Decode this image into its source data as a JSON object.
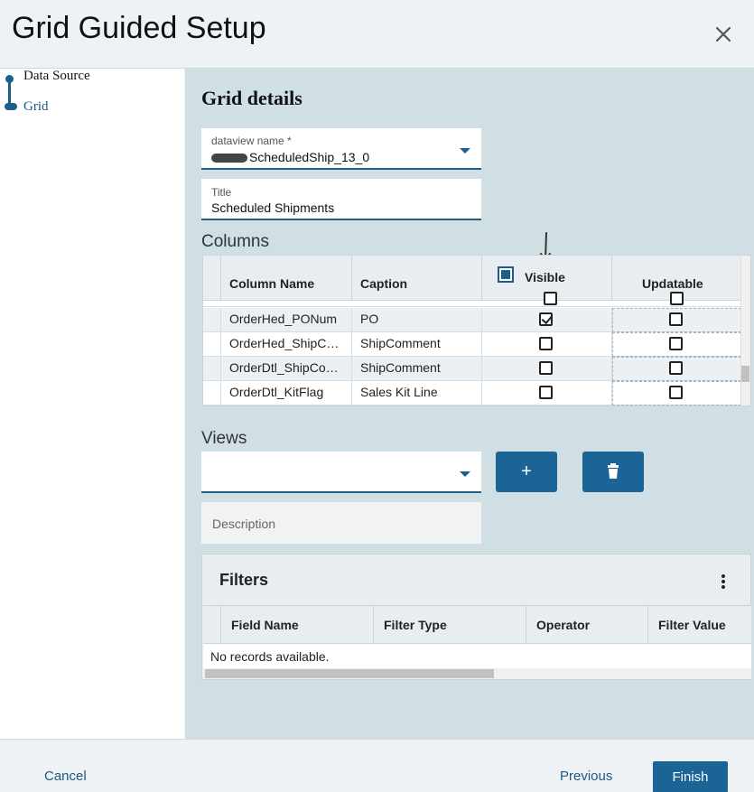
{
  "header": {
    "title": "Grid Guided Setup",
    "close_icon": "close-icon"
  },
  "steps": [
    {
      "label": "Data Source"
    },
    {
      "label": "Grid"
    }
  ],
  "main": {
    "section_title": "Grid details",
    "dataview": {
      "label": "dataview name *",
      "value": "ScheduledShip_13_0"
    },
    "title_field": {
      "label": "Title",
      "value": "Scheduled Shipments"
    },
    "columns_heading": "Columns",
    "columns_grid": {
      "headers": [
        "Column Name",
        "Caption",
        "Visible",
        "Updatable"
      ],
      "rows": [
        {
          "name": "OrderHed_PONum",
          "caption": "PO",
          "visible": true,
          "updatable": false
        },
        {
          "name": "OrderHed_ShipC…",
          "caption": "ShipComment",
          "visible": false,
          "updatable": false
        },
        {
          "name": "OrderDtl_ShipCo…",
          "caption": "ShipComment",
          "visible": false,
          "updatable": false
        },
        {
          "name": "OrderDtl_KitFlag",
          "caption": "Sales Kit Line",
          "visible": false,
          "updatable": false
        }
      ]
    },
    "views_heading": "Views",
    "add_button_label": "+",
    "delete_icon": "trash-icon",
    "description_placeholder": "Description",
    "filters": {
      "title": "Filters",
      "headers": [
        "Field Name",
        "Filter Type",
        "Operator",
        "Filter Value"
      ],
      "empty_message": "No records available."
    }
  },
  "footer": {
    "cancel": "Cancel",
    "previous": "Previous",
    "finish": "Finish"
  },
  "colors": {
    "accent": "#1a6596",
    "panel": "#d0dfe4"
  }
}
